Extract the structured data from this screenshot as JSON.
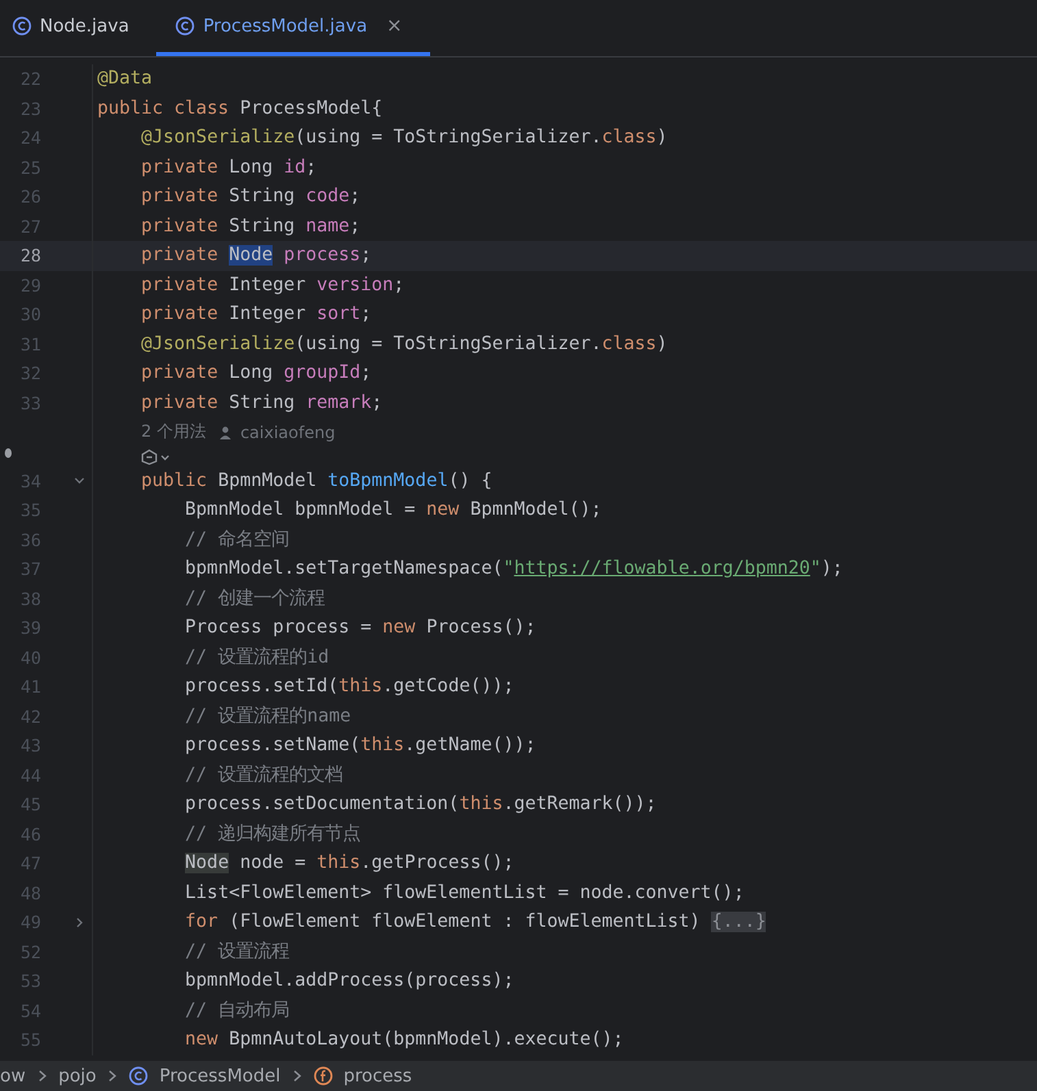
{
  "tabs": [
    {
      "label": "Node.java",
      "selected": false
    },
    {
      "label": "ProcessModel.java",
      "selected": true,
      "close": "×"
    }
  ],
  "lines": [
    {
      "kind": "code",
      "number": "22",
      "current": false,
      "tokens": [
        {
          "t": "@Data",
          "kind": "annotation"
        }
      ]
    },
    {
      "kind": "code",
      "number": "23",
      "current": false,
      "tokens": [
        {
          "t": "public class ",
          "kind": "keyword"
        },
        {
          "t": "ProcessModel{",
          "kind": "plain"
        }
      ]
    },
    {
      "kind": "code",
      "number": "24",
      "current": false,
      "tokens": [
        {
          "t": "    @JsonSerialize",
          "kind": "annotation"
        },
        {
          "t": "(using = ToStringSerializer.",
          "kind": "plain"
        },
        {
          "t": "class",
          "kind": "keyword"
        },
        {
          "t": ")",
          "kind": "plain"
        }
      ]
    },
    {
      "kind": "code",
      "number": "25",
      "current": false,
      "tokens": [
        {
          "t": "    private ",
          "kind": "keyword"
        },
        {
          "t": "Long ",
          "kind": "plain"
        },
        {
          "t": "id",
          "kind": "field"
        },
        {
          "t": ";",
          "kind": "plain"
        }
      ]
    },
    {
      "kind": "code",
      "number": "26",
      "current": false,
      "tokens": [
        {
          "t": "    private ",
          "kind": "keyword"
        },
        {
          "t": "String ",
          "kind": "plain"
        },
        {
          "t": "code",
          "kind": "field"
        },
        {
          "t": ";",
          "kind": "plain"
        }
      ]
    },
    {
      "kind": "code",
      "number": "27",
      "current": false,
      "tokens": [
        {
          "t": "    private ",
          "kind": "keyword"
        },
        {
          "t": "String ",
          "kind": "plain"
        },
        {
          "t": "name",
          "kind": "field"
        },
        {
          "t": ";",
          "kind": "plain"
        }
      ]
    },
    {
      "kind": "code",
      "number": "28",
      "current": true,
      "tokens": [
        {
          "t": "    private ",
          "kind": "keyword"
        },
        {
          "t": "Node",
          "kind": "selection"
        },
        {
          "t": " process",
          "kind": "field"
        },
        {
          "t": ";",
          "kind": "plain"
        }
      ]
    },
    {
      "kind": "code",
      "number": "29",
      "current": false,
      "tokens": [
        {
          "t": "    private ",
          "kind": "keyword"
        },
        {
          "t": "Integer ",
          "kind": "plain"
        },
        {
          "t": "version",
          "kind": "field"
        },
        {
          "t": ";",
          "kind": "plain"
        }
      ]
    },
    {
      "kind": "code",
      "number": "30",
      "current": false,
      "tokens": [
        {
          "t": "    private ",
          "kind": "keyword"
        },
        {
          "t": "Integer ",
          "kind": "plain"
        },
        {
          "t": "sort",
          "kind": "field"
        },
        {
          "t": ";",
          "kind": "plain"
        }
      ]
    },
    {
      "kind": "code",
      "number": "31",
      "current": false,
      "tokens": [
        {
          "t": "    @JsonSerialize",
          "kind": "annotation"
        },
        {
          "t": "(using = ToStringSerializer.",
          "kind": "plain"
        },
        {
          "t": "class",
          "kind": "keyword"
        },
        {
          "t": ")",
          "kind": "plain"
        }
      ]
    },
    {
      "kind": "code",
      "number": "32",
      "current": false,
      "tokens": [
        {
          "t": "    private ",
          "kind": "keyword"
        },
        {
          "t": "Long ",
          "kind": "plain"
        },
        {
          "t": "groupId",
          "kind": "field"
        },
        {
          "t": ";",
          "kind": "plain"
        }
      ]
    },
    {
      "kind": "code",
      "number": "33",
      "current": false,
      "tokens": [
        {
          "t": "    private ",
          "kind": "keyword"
        },
        {
          "t": "String ",
          "kind": "plain"
        },
        {
          "t": "remark",
          "kind": "field"
        },
        {
          "t": ";",
          "kind": "plain"
        }
      ]
    },
    {
      "kind": "usage-hint",
      "usages": "2 个用法",
      "author": "caixiaofeng"
    },
    {
      "kind": "ai-hint"
    },
    {
      "kind": "code",
      "number": "34",
      "current": false,
      "collapsed": false,
      "tokens": [
        {
          "t": "    public ",
          "kind": "keyword"
        },
        {
          "t": "BpmnModel ",
          "kind": "plain"
        },
        {
          "t": "toBpmnModel",
          "kind": "method"
        },
        {
          "t": "() {",
          "kind": "plain"
        }
      ]
    },
    {
      "kind": "code",
      "number": "35",
      "current": false,
      "tokens": [
        {
          "t": "        BpmnModel bpmnModel = ",
          "kind": "plain"
        },
        {
          "t": "new ",
          "kind": "keyword"
        },
        {
          "t": "BpmnModel();",
          "kind": "plain"
        }
      ]
    },
    {
      "kind": "code",
      "number": "36",
      "current": false,
      "tokens": [
        {
          "t": "        // 命名空间",
          "kind": "comment"
        }
      ]
    },
    {
      "kind": "code",
      "number": "37",
      "current": false,
      "tokens": [
        {
          "t": "        bpmnModel.setTargetNamespace(",
          "kind": "plain"
        },
        {
          "t": "\"",
          "kind": "string"
        },
        {
          "t": "https://flowable.org/bpmn20",
          "kind": "link"
        },
        {
          "t": "\"",
          "kind": "string"
        },
        {
          "t": ");",
          "kind": "plain"
        }
      ]
    },
    {
      "kind": "code",
      "number": "38",
      "current": false,
      "tokens": [
        {
          "t": "        // 创建一个流程",
          "kind": "comment"
        }
      ]
    },
    {
      "kind": "code",
      "number": "39",
      "current": false,
      "tokens": [
        {
          "t": "        Process process = ",
          "kind": "plain"
        },
        {
          "t": "new ",
          "kind": "keyword"
        },
        {
          "t": "Process();",
          "kind": "plain"
        }
      ]
    },
    {
      "kind": "code",
      "number": "40",
      "current": false,
      "tokens": [
        {
          "t": "        // 设置流程的id",
          "kind": "comment"
        }
      ]
    },
    {
      "kind": "code",
      "number": "41",
      "current": false,
      "tokens": [
        {
          "t": "        process.setId(",
          "kind": "plain"
        },
        {
          "t": "this",
          "kind": "keyword"
        },
        {
          "t": ".getCode());",
          "kind": "plain"
        }
      ]
    },
    {
      "kind": "code",
      "number": "42",
      "current": false,
      "tokens": [
        {
          "t": "        // 设置流程的name",
          "kind": "comment"
        }
      ]
    },
    {
      "kind": "code",
      "number": "43",
      "current": false,
      "tokens": [
        {
          "t": "        process.setName(",
          "kind": "plain"
        },
        {
          "t": "this",
          "kind": "keyword"
        },
        {
          "t": ".getName());",
          "kind": "plain"
        }
      ]
    },
    {
      "kind": "code",
      "number": "44",
      "current": false,
      "tokens": [
        {
          "t": "        // 设置流程的文档",
          "kind": "comment"
        }
      ]
    },
    {
      "kind": "code",
      "number": "45",
      "current": false,
      "tokens": [
        {
          "t": "        process.setDocumentation(",
          "kind": "plain"
        },
        {
          "t": "this",
          "kind": "keyword"
        },
        {
          "t": ".getRemark());",
          "kind": "plain"
        }
      ]
    },
    {
      "kind": "code",
      "number": "46",
      "current": false,
      "tokens": [
        {
          "t": "        // 递归构建所有节点",
          "kind": "comment"
        }
      ]
    },
    {
      "kind": "code",
      "number": "47",
      "current": false,
      "tokens": [
        {
          "t": "        Node",
          "kind": "occurrence"
        },
        {
          "t": " node = ",
          "kind": "plain"
        },
        {
          "t": "this",
          "kind": "keyword"
        },
        {
          "t": ".getProcess();",
          "kind": "plain"
        }
      ]
    },
    {
      "kind": "code",
      "number": "48",
      "current": false,
      "tokens": [
        {
          "t": "        List<FlowElement> flowElementList = node.convert();",
          "kind": "plain"
        }
      ]
    },
    {
      "kind": "code",
      "number": "49",
      "current": false,
      "collapsed": true,
      "tokens": [
        {
          "t": "        for ",
          "kind": "keyword"
        },
        {
          "t": "(FlowElement flowElement : flowElementList) ",
          "kind": "plain"
        },
        {
          "t": "{...}",
          "kind": "folded"
        }
      ]
    },
    {
      "kind": "code",
      "number": "52",
      "current": false,
      "tokens": [
        {
          "t": "        // 设置流程",
          "kind": "comment"
        }
      ]
    },
    {
      "kind": "code",
      "number": "53",
      "current": false,
      "tokens": [
        {
          "t": "        bpmnModel.addProcess(process);",
          "kind": "plain"
        }
      ]
    },
    {
      "kind": "code",
      "number": "54",
      "current": false,
      "tokens": [
        {
          "t": "        // 自动布局",
          "kind": "comment"
        }
      ]
    },
    {
      "kind": "code",
      "number": "55",
      "current": false,
      "tokens": [
        {
          "t": "        new ",
          "kind": "keyword"
        },
        {
          "t": "BpmnAutoLayout(bpmnModel).execute();",
          "kind": "plain"
        }
      ]
    }
  ],
  "breadcrumb": [
    {
      "label": "ow",
      "kind": "folder"
    },
    {
      "label": "pojo",
      "kind": "folder"
    },
    {
      "label": "ProcessModel",
      "kind": "class"
    },
    {
      "label": "process",
      "kind": "field"
    }
  ]
}
